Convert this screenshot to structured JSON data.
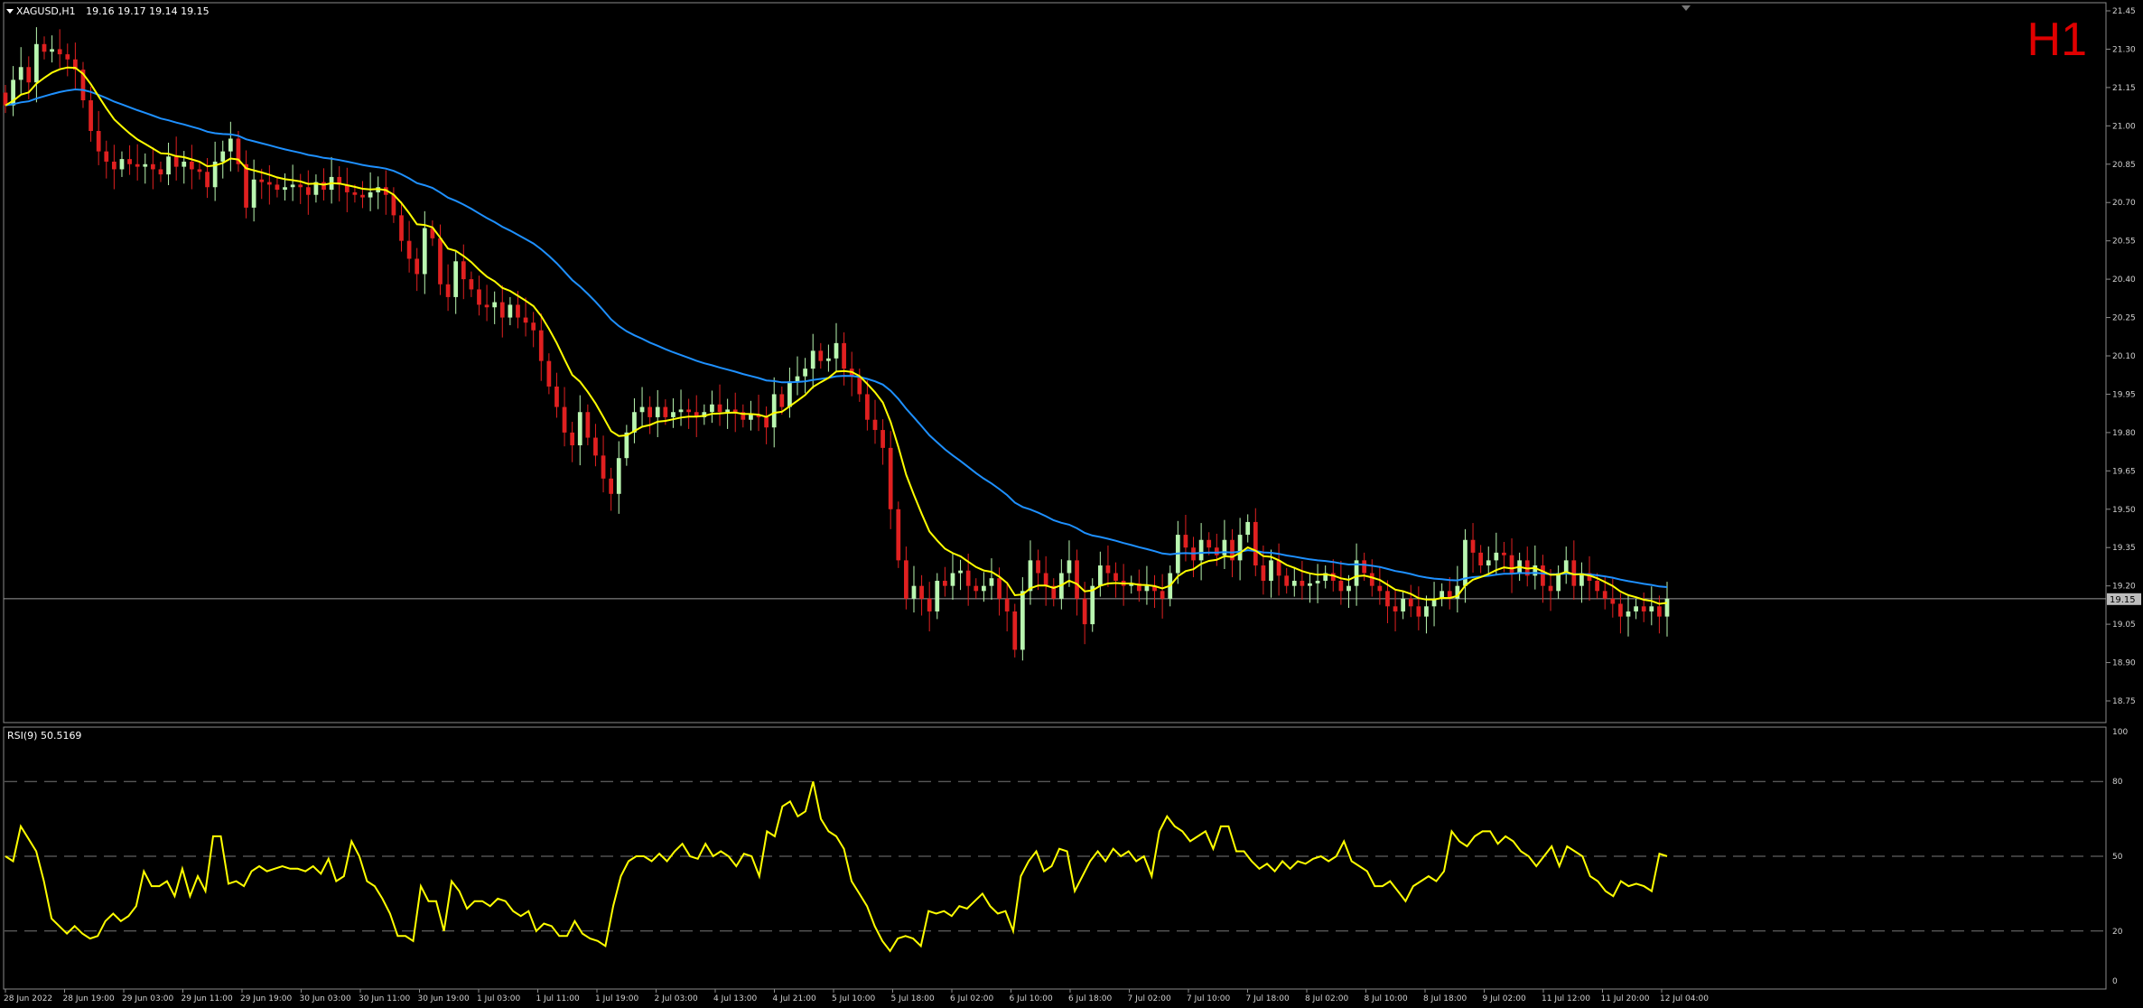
{
  "header": {
    "symbol": "XAGUSD,H1",
    "ohlc": "19.16 19.17 19.14 19.15",
    "timeframe_badge": "H1"
  },
  "rsi_panel": {
    "label": "RSI(9) 50.5169",
    "levels": [
      20,
      50,
      80
    ],
    "range": [
      0,
      100
    ]
  },
  "colors": {
    "background": "#000000",
    "bull": "#b9f6b0",
    "bear": "#e02020",
    "ma_fast": "#ffff00",
    "ma_slow": "#1e90ff",
    "rsi": "#ffff00",
    "timeframe": "#e00000"
  },
  "chart_data": [
    {
      "type": "candlestick",
      "title": "XAGUSD,H1",
      "ylim": [
        18.75,
        21.45
      ],
      "ytick_labels": [
        "21.45",
        "21.30",
        "21.15",
        "21.00",
        "20.85",
        "20.70",
        "20.55",
        "20.40",
        "20.25",
        "20.10",
        "19.95",
        "19.80",
        "19.65",
        "19.50",
        "19.35",
        "19.20",
        "19.05",
        "18.90",
        "18.75"
      ],
      "current_price_label": "19.15",
      "current_price": 19.15,
      "xtick_labels": [
        "28 Jun 2022",
        "28 Jun 19:00",
        "29 Jun 03:00",
        "29 Jun 11:00",
        "29 Jun 19:00",
        "30 Jun 03:00",
        "30 Jun 11:00",
        "30 Jun 19:00",
        "1 Jul 03:00",
        "1 Jul 11:00",
        "1 Jul 19:00",
        "2 Jul 03:00",
        "4 Jul 13:00",
        "4 Jul 21:00",
        "5 Jul 10:00",
        "5 Jul 18:00",
        "6 Jul 02:00",
        "6 Jul 10:00",
        "6 Jul 18:00",
        "7 Jul 02:00",
        "7 Jul 10:00",
        "7 Jul 18:00",
        "8 Jul 02:00",
        "8 Jul 10:00",
        "8 Jul 18:00",
        "9 Jul 02:00",
        "11 Jul 12:00",
        "11 Jul 20:00",
        "12 Jul 04:00"
      ],
      "close": [
        21.08,
        21.18,
        21.23,
        21.17,
        21.32,
        21.29,
        21.3,
        21.28,
        21.26,
        21.22,
        21.1,
        20.98,
        20.9,
        20.86,
        20.83,
        20.87,
        20.85,
        20.84,
        20.85,
        20.83,
        20.81,
        20.88,
        20.84,
        20.86,
        20.83,
        20.82,
        20.76,
        20.86,
        20.9,
        20.95,
        20.85,
        20.68,
        20.79,
        20.78,
        20.77,
        20.75,
        20.76,
        20.77,
        20.76,
        20.73,
        20.78,
        20.75,
        20.8,
        20.77,
        20.74,
        20.73,
        20.72,
        20.74,
        20.76,
        20.73,
        20.65,
        20.55,
        20.48,
        20.42,
        20.6,
        20.56,
        20.38,
        20.33,
        20.47,
        20.4,
        20.36,
        20.3,
        20.29,
        20.31,
        20.25,
        20.3,
        20.25,
        20.23,
        20.2,
        20.08,
        19.98,
        19.9,
        19.8,
        19.75,
        19.88,
        19.78,
        19.71,
        19.62,
        19.56,
        19.7,
        19.8,
        19.88,
        19.9,
        19.86,
        19.9,
        19.86,
        19.88,
        19.89,
        19.88,
        19.86,
        19.88,
        19.91,
        19.88,
        19.89,
        19.88,
        19.85,
        19.87,
        19.86,
        19.82,
        19.95,
        19.9,
        20.0,
        20.02,
        20.05,
        20.12,
        20.08,
        20.09,
        20.15,
        20.05,
        20.02,
        19.95,
        19.85,
        19.81,
        19.74,
        19.5,
        19.3,
        19.15,
        19.2,
        19.15,
        19.1,
        19.22,
        19.2,
        19.25,
        19.26,
        19.2,
        19.18,
        19.2,
        19.23,
        19.15,
        19.1,
        18.95,
        19.18,
        19.3,
        19.25,
        19.2,
        19.15,
        19.25,
        19.3,
        19.15,
        19.05,
        19.2,
        19.28,
        19.25,
        19.22,
        19.2,
        19.21,
        19.18,
        19.2,
        19.18,
        19.15,
        19.25,
        19.4,
        19.35,
        19.3,
        19.38,
        19.35,
        19.32,
        19.38,
        19.3,
        19.4,
        19.45,
        19.28,
        19.22,
        19.3,
        19.24,
        19.2,
        19.22,
        19.2,
        19.21,
        19.22,
        19.25,
        19.22,
        19.18,
        19.2,
        19.3,
        19.25,
        19.2,
        19.18,
        19.12,
        19.1,
        19.15,
        19.12,
        19.08,
        19.12,
        19.15,
        19.18,
        19.15,
        19.2,
        19.38,
        19.33,
        19.28,
        19.3,
        19.33,
        19.32,
        19.25,
        19.3,
        19.24,
        19.28,
        19.2,
        19.18,
        19.25,
        19.3,
        19.2,
        19.25,
        19.22,
        19.18,
        19.15,
        19.13,
        19.08,
        19.1,
        19.12,
        19.1,
        19.12,
        19.08,
        19.15
      ]
    },
    {
      "type": "line",
      "title": "RSI(9) 50.5169",
      "ylim": [
        0,
        100
      ],
      "ytick_labels": [
        "100",
        "80",
        "50",
        "20",
        "0"
      ],
      "levels": [
        20,
        50,
        80
      ],
      "values": [
        50,
        48,
        62,
        57,
        52,
        40,
        25,
        22,
        19,
        22,
        19,
        17,
        18,
        24,
        27,
        24,
        26,
        30,
        44,
        38,
        38,
        40,
        34,
        45,
        34,
        42,
        36,
        58,
        58,
        39,
        40,
        38,
        44,
        46,
        44,
        45,
        46,
        45,
        45,
        44,
        46,
        43,
        49,
        40,
        42,
        56,
        50,
        40,
        38,
        33,
        27,
        18,
        18,
        16,
        38,
        32,
        32,
        20,
        40,
        36,
        29,
        32,
        32,
        30,
        33,
        32,
        28,
        26,
        28,
        20,
        23,
        22,
        18,
        18,
        24,
        19,
        17,
        16,
        14,
        30,
        42,
        48,
        50,
        50,
        48,
        51,
        48,
        52,
        55,
        50,
        49,
        55,
        50,
        52,
        50,
        46,
        51,
        50,
        42,
        60,
        58,
        70,
        72,
        66,
        68,
        80,
        65,
        60,
        58,
        53,
        40,
        35,
        30,
        22,
        16,
        12,
        17,
        18,
        17,
        14,
        28,
        27,
        28,
        26,
        30,
        29,
        32,
        35,
        30,
        27,
        28,
        20,
        42,
        48,
        52,
        44,
        46,
        53,
        52,
        36,
        42,
        48,
        52,
        48,
        53,
        50,
        52,
        48,
        50,
        42,
        60,
        66,
        62,
        60,
        56,
        58,
        60,
        53,
        62,
        62,
        52,
        52,
        48,
        45,
        47,
        44,
        48,
        45,
        48,
        47,
        49,
        50,
        48,
        50,
        56,
        48,
        46,
        44,
        38,
        38,
        40,
        36,
        32,
        38,
        40,
        42,
        40,
        44,
        60,
        56,
        54,
        58,
        60,
        60,
        55,
        58,
        56,
        52,
        50,
        46,
        50,
        54,
        46,
        54,
        52,
        50,
        42,
        40,
        36,
        34,
        40,
        38,
        39,
        38,
        36,
        51,
        50
      ]
    }
  ]
}
